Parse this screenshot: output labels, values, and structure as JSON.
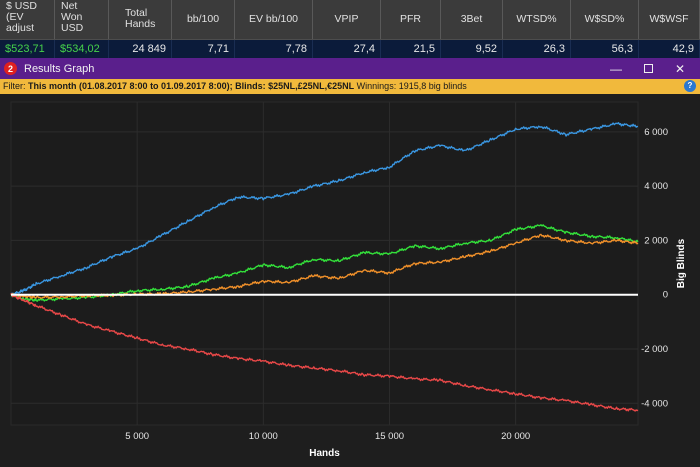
{
  "stats": {
    "headers": [
      "$ USD\n(EV\nadjust",
      "Net\nWon\nUSD",
      "Total\nHands",
      "bb/100",
      "EV bb/100",
      "VPIP",
      "PFR",
      "3Bet",
      "WTSD%",
      "W$SD%",
      "W$WSF"
    ],
    "values": [
      "$523,71",
      "$534,02",
      "24 849",
      "7,71",
      "7,78",
      "27,4",
      "21,5",
      "9,52",
      "26,3",
      "56,3",
      "42,9"
    ]
  },
  "window": {
    "title": "Results Graph",
    "icon_glyph": "2",
    "minimize_glyph": "—",
    "close_glyph": "✕"
  },
  "filter": {
    "label": "Filter:",
    "period": "This month (01.08.2017 8:00 to 01.09.2017 8:00)",
    "blinds": "; Blinds: $25NL,£25NL,€25NL",
    "winnings": " Winnings: 1915,8 big blinds",
    "help_glyph": "?"
  },
  "chart_data": {
    "type": "line",
    "xlabel": "Hands",
    "ylabel": "Big Blinds",
    "xlim": [
      0,
      24849
    ],
    "ylim": [
      -4800,
      7100
    ],
    "x_ticks": [
      5000,
      10000,
      15000,
      20000
    ],
    "x_tick_labels": [
      "5 000",
      "10 000",
      "15 000",
      "20 000"
    ],
    "y_ticks": [
      6000,
      4000,
      2000,
      0,
      -2000,
      -4000
    ],
    "y_tick_labels": [
      "6 000",
      "4 000",
      "2 000",
      "0",
      "-2 000",
      "-4 000"
    ],
    "grid": true,
    "x": [
      0,
      500,
      1000,
      2000,
      3000,
      4000,
      5000,
      6000,
      7000,
      8000,
      9000,
      10000,
      11000,
      12000,
      13000,
      14000,
      15000,
      16000,
      17000,
      18000,
      19000,
      20000,
      21000,
      22000,
      23000,
      24000,
      24849
    ],
    "series": [
      {
        "color": "#3a96e0",
        "values": [
          0,
          150,
          400,
          700,
          1000,
          1400,
          1700,
          2200,
          2700,
          3200,
          3600,
          3550,
          3700,
          4000,
          4200,
          4500,
          4700,
          5300,
          5500,
          5300,
          5700,
          6100,
          6200,
          5900,
          6100,
          6300,
          6200
        ]
      },
      {
        "color": "#33e03a",
        "values": [
          0,
          -150,
          -200,
          -150,
          -100,
          0,
          150,
          200,
          300,
          600,
          800,
          1100,
          1000,
          1300,
          1250,
          1550,
          1500,
          1800,
          1700,
          1900,
          2000,
          2400,
          2550,
          2300,
          2150,
          2100,
          1950
        ]
      },
      {
        "color": "#f0902a",
        "values": [
          0,
          -50,
          -100,
          -80,
          -30,
          -20,
          20,
          30,
          100,
          200,
          300,
          500,
          450,
          700,
          600,
          900,
          800,
          1150,
          1200,
          1400,
          1600,
          1900,
          2200,
          2000,
          1900,
          2000,
          1900
        ]
      },
      {
        "color": "#e84848",
        "values": [
          0,
          -200,
          -400,
          -750,
          -1100,
          -1350,
          -1600,
          -1850,
          -2000,
          -2200,
          -2350,
          -2450,
          -2600,
          -2700,
          -2800,
          -2950,
          -3000,
          -3100,
          -3150,
          -3350,
          -3500,
          -3650,
          -3800,
          -3900,
          -4050,
          -4200,
          -4250
        ]
      },
      {
        "color": "#ffffff",
        "values": [
          0,
          0,
          0,
          0,
          0,
          0,
          0,
          0,
          0,
          0,
          0,
          0,
          0,
          0,
          0,
          0,
          0,
          0,
          0,
          0,
          0,
          0,
          0,
          0,
          0,
          0,
          0
        ]
      }
    ]
  }
}
